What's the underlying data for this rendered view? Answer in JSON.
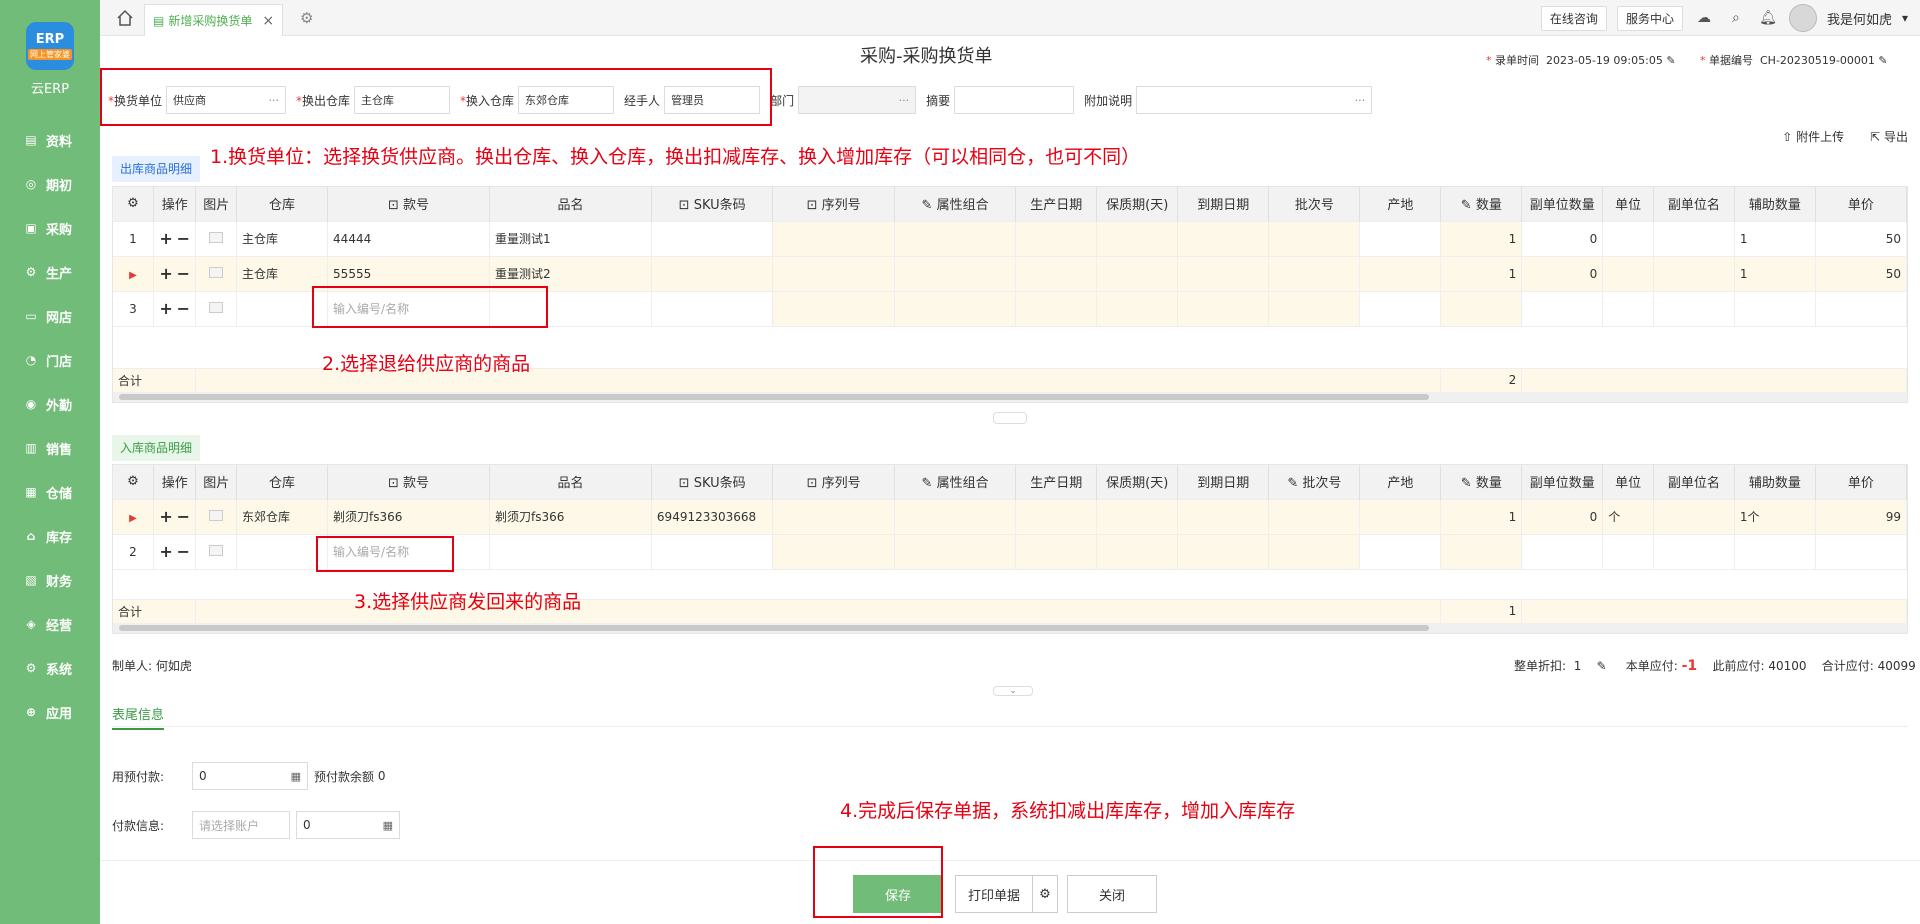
{
  "sidebar": {
    "logo_text": "ERP",
    "logo_badge": "网上管家婆",
    "app_name": "云ERP",
    "items": [
      {
        "label": "资料",
        "icon": "▤"
      },
      {
        "label": "期初",
        "icon": "◎"
      },
      {
        "label": "采购",
        "icon": "▣"
      },
      {
        "label": "生产",
        "icon": "⚙"
      },
      {
        "label": "网店",
        "icon": "▭"
      },
      {
        "label": "门店",
        "icon": "◔"
      },
      {
        "label": "外勤",
        "icon": "◉"
      },
      {
        "label": "销售",
        "icon": "▥"
      },
      {
        "label": "仓储",
        "icon": "▦"
      },
      {
        "label": "库存",
        "icon": "⌂"
      },
      {
        "label": "财务",
        "icon": "▧"
      },
      {
        "label": "经营",
        "icon": "◈"
      },
      {
        "label": "系统",
        "icon": "⚙"
      },
      {
        "label": "应用",
        "icon": "⊕"
      }
    ]
  },
  "topbar": {
    "tab_label": "新增采购换货单",
    "online_consult": "在线咨询",
    "service_center": "服务中心",
    "user_name": "我是何如虎"
  },
  "header": {
    "title": "采购-采购换货单",
    "record_time_label": "录单时间",
    "record_time": "2023-05-19 09:05:05",
    "doc_no_label": "单据编号",
    "doc_no": "CH-20230519-00001",
    "fields": {
      "exchange_unit_label": "换货单位",
      "exchange_unit": "供应商",
      "out_wh_label": "换出仓库",
      "out_wh": "主仓库",
      "in_wh_label": "换入仓库",
      "in_wh": "东郊仓库",
      "handler_label": "经手人",
      "handler": "管理员",
      "dept_label": "部门",
      "summary_label": "摘要",
      "note_label": "附加说明"
    },
    "attach_upload": "附件上传",
    "export": "导出"
  },
  "annotations": {
    "a1": "1.换货单位：选择换货供应商。换出仓库、换入仓库，换出扣减库存、换入增加库存（可以相同仓，也可不同）",
    "a2": "2.选择退给供应商的商品",
    "a3": "3.选择供应商发回来的商品",
    "a4": "4.完成后保存单据，系统扣减出库库存，增加入库库存"
  },
  "out_section": {
    "title": "出库商品明细",
    "headers": [
      "操作",
      "图片",
      "仓库",
      "款号",
      "品名",
      "SKU条码",
      "序列号",
      "属性组合",
      "生产日期",
      "保质期(天)",
      "到期日期",
      "批次号",
      "产地",
      "数量",
      "副单位数量",
      "单位",
      "副单位名",
      "辅助数量",
      "单价"
    ],
    "rows": [
      {
        "no": "1",
        "wh": "主仓库",
        "code": "44444",
        "name": "重量测试1",
        "qty": "1",
        "sub_qty": "0",
        "aux": "1",
        "price": "50"
      },
      {
        "no": "",
        "wh": "主仓库",
        "code": "55555",
        "name": "重量测试2",
        "qty": "1",
        "sub_qty": "0",
        "aux": "1",
        "price": "50"
      },
      {
        "no": "3",
        "placeholder": "输入编号/名称"
      }
    ],
    "total_label": "合计",
    "total_qty": "2"
  },
  "in_section": {
    "title": "入库商品明细",
    "rows": [
      {
        "wh": "东郊仓库",
        "code": "剃须刀fs366",
        "name": "剃须刀fs366",
        "sku": "6949123303668",
        "qty": "1",
        "sub_qty": "0",
        "unit": "个",
        "aux": "1个",
        "price": "99"
      },
      {
        "no": "2",
        "placeholder": "输入编号/名称"
      }
    ],
    "total_label": "合计",
    "total_qty": "1"
  },
  "footer": {
    "maker_label": "制单人:",
    "maker": "何如虎",
    "discount_label": "整单折扣:",
    "discount": "1",
    "payable_label": "本单应付:",
    "payable": "-1",
    "prev_payable_label": "此前应付:",
    "prev_payable": "40100",
    "total_payable_label": "合计应付:",
    "total_payable": "40099",
    "tail_tab": "表尾信息",
    "prepay_label": "用预付款:",
    "prepay_value": "0",
    "prepay_balance_label": "预付款余额",
    "prepay_balance": "0",
    "payinfo_label": "付款信息:",
    "account_placeholder": "请选择账户",
    "pay_amount": "0"
  },
  "buttons": {
    "save": "保存",
    "print": "打印单据",
    "close": "关闭"
  },
  "colors": {
    "sidebar": "#71bc78",
    "annotation": "#e60012",
    "accent_blue": "#2a6fd8"
  }
}
